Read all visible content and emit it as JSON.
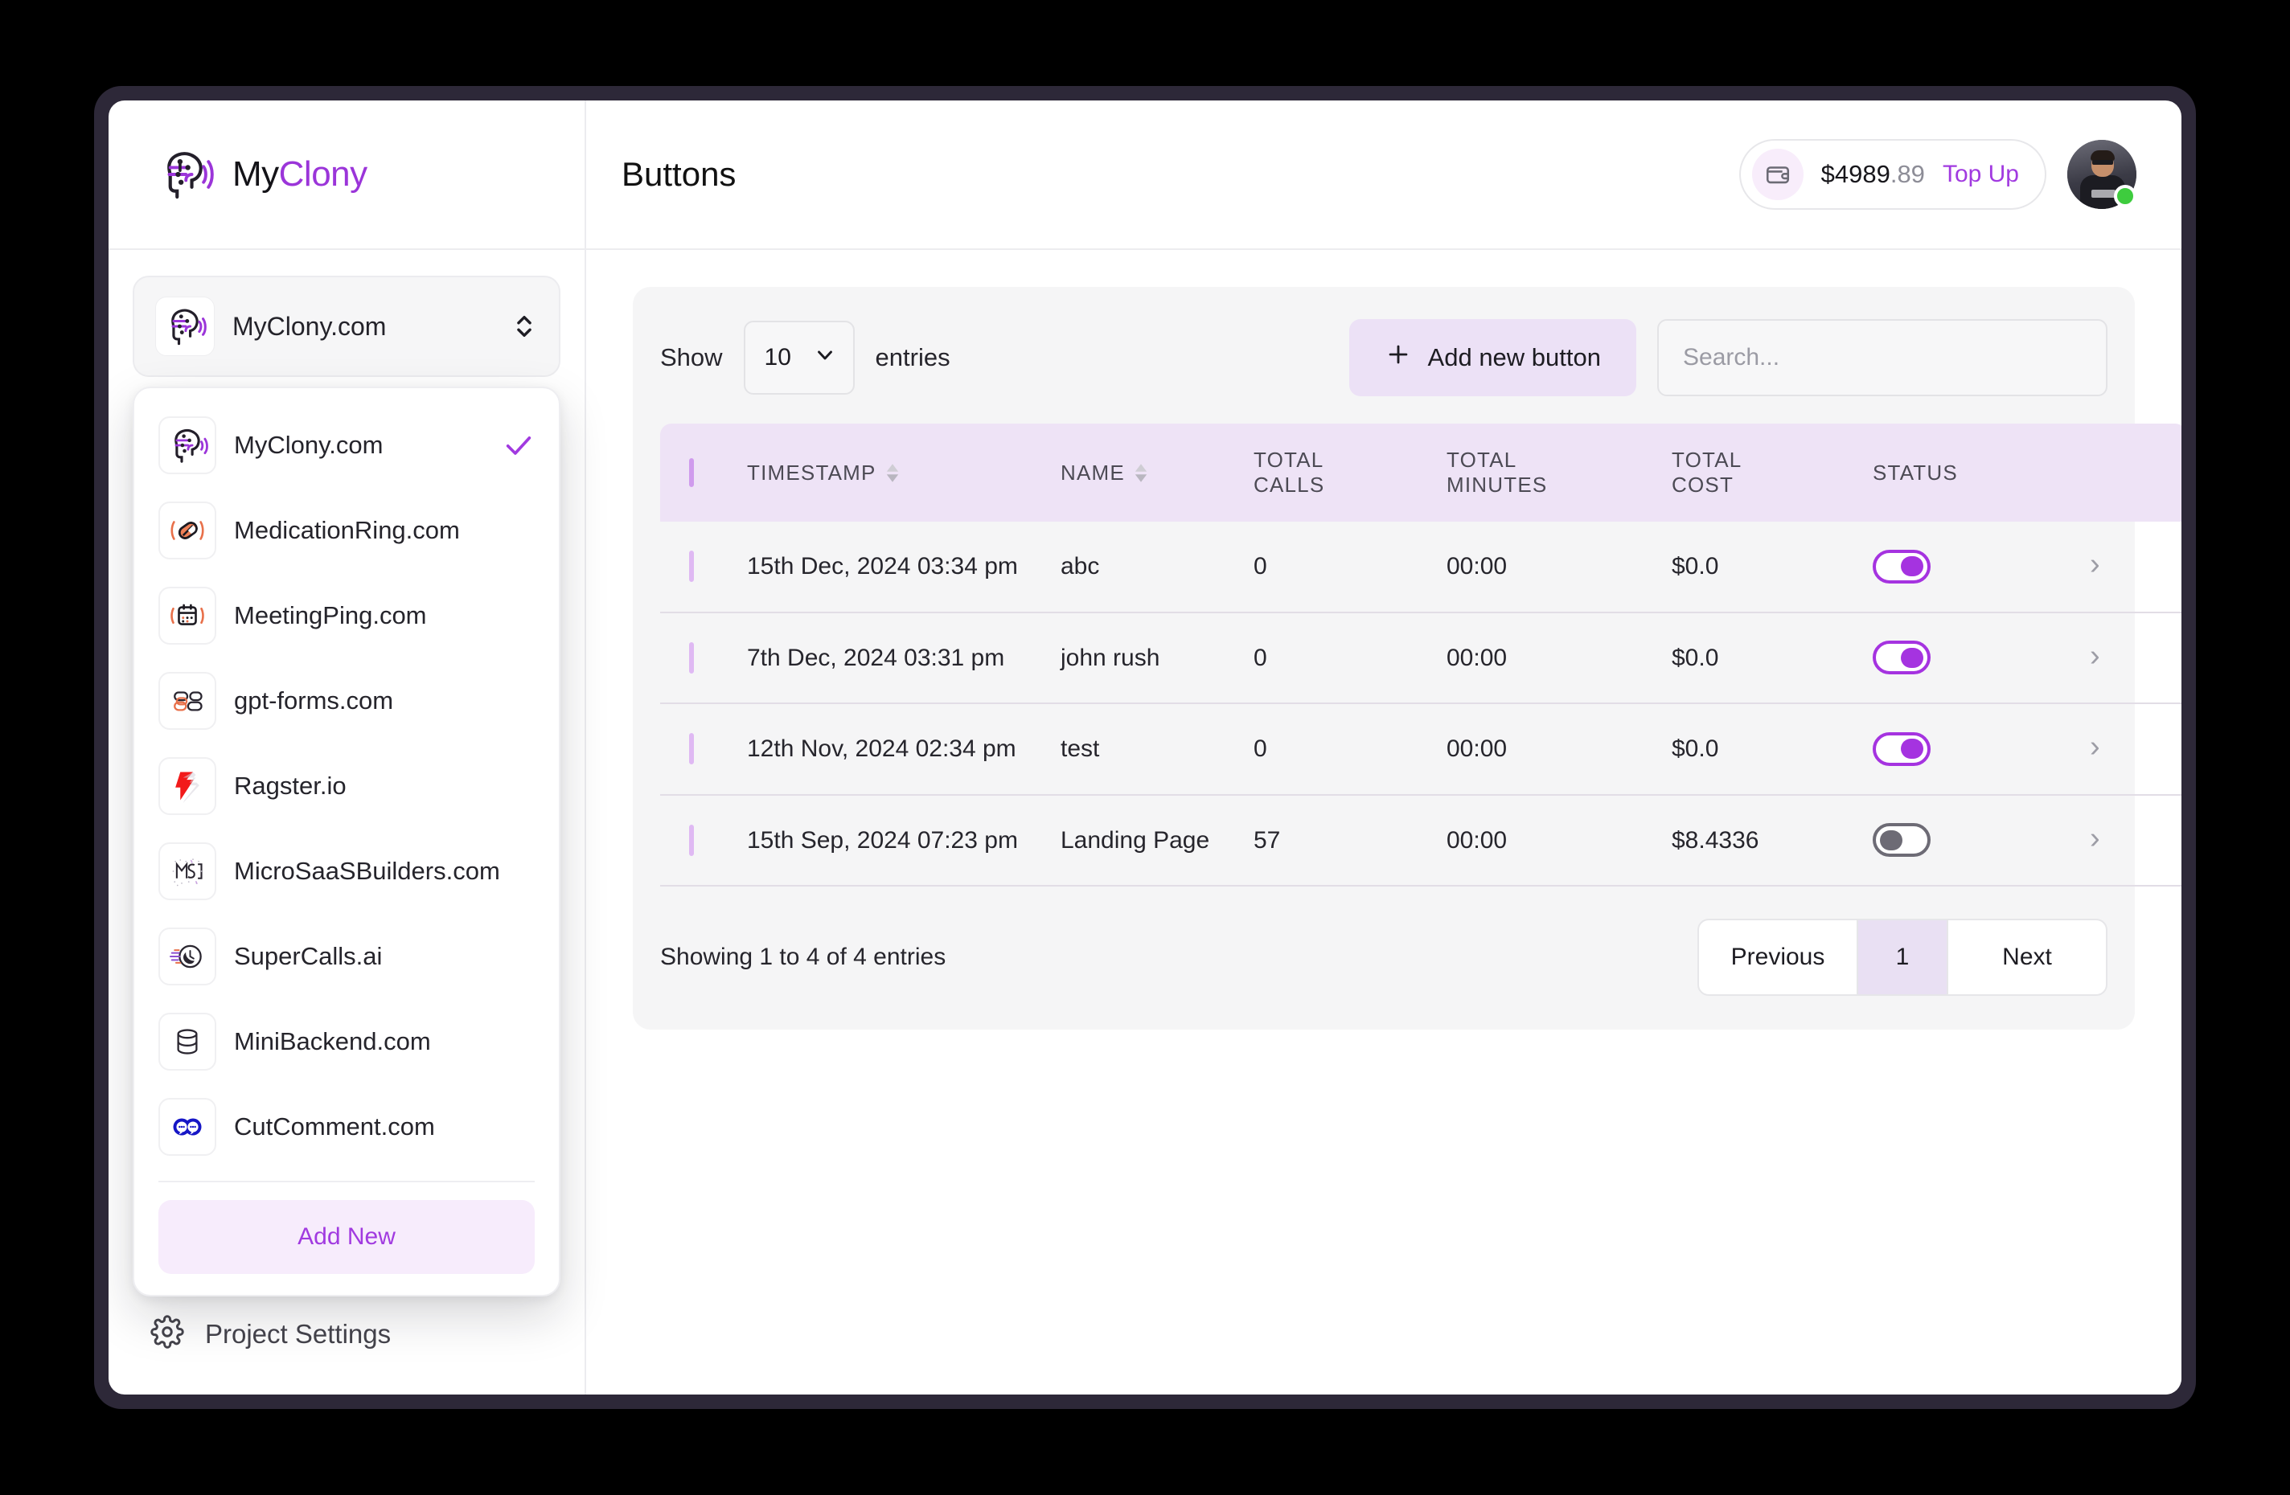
{
  "brand": {
    "name_dark": "My",
    "name_accent": "Clony",
    "logo_icon": "brain-wave-icon"
  },
  "header": {
    "page_title": "Buttons",
    "wallet": {
      "icon": "wallet-icon",
      "amount_main": "$4989",
      "amount_cents": ".89",
      "topup_label": "Top Up"
    },
    "avatar": {
      "name": "user-avatar",
      "status": "online"
    }
  },
  "sidebar": {
    "current_project": {
      "label": "MyClony.com",
      "icon": "brain-wave-icon"
    },
    "settings": {
      "label": "Project Settings",
      "icon": "gear-icon"
    },
    "dropdown": {
      "add_new_label": "Add New",
      "items": [
        {
          "label": "MyClony.com",
          "icon": "brain-wave-icon",
          "selected": true
        },
        {
          "label": "MedicationRing.com",
          "icon": "pill-ring-icon",
          "selected": false
        },
        {
          "label": "MeetingPing.com",
          "icon": "calendar-ring-icon",
          "selected": false
        },
        {
          "label": "gpt-forms.com",
          "icon": "forms-shapes-icon",
          "selected": false
        },
        {
          "label": "Ragster.io",
          "icon": "ragster-r-icon",
          "selected": false
        },
        {
          "label": "MicroSaaSBuilders.com",
          "icon": "msb-glyph-icon",
          "selected": false
        },
        {
          "label": "SuperCalls.ai",
          "icon": "phone-clock-icon",
          "selected": false
        },
        {
          "label": "MiniBackend.com",
          "icon": "database-icon",
          "selected": false
        },
        {
          "label": "CutComment.com",
          "icon": "double-comment-icon",
          "selected": false
        }
      ]
    }
  },
  "toolbar": {
    "show_label": "Show",
    "entries_label": "entries",
    "page_length": "10",
    "add_button_label": "Add new button",
    "search_placeholder": "Search..."
  },
  "table": {
    "columns": [
      "TIMESTAMP",
      "NAME",
      "TOTAL CALLS",
      "TOTAL MINUTES",
      "TOTAL COST",
      "STATUS"
    ],
    "col_total_calls_l1": "TOTAL",
    "col_total_calls_l2": "CALLS",
    "col_total_minutes_l1": "TOTAL",
    "col_total_minutes_l2": "MINUTES",
    "col_total_cost_l1": "TOTAL",
    "col_total_cost_l2": "COST",
    "rows": [
      {
        "timestamp": "15th Dec, 2024 03:34 pm",
        "name": "abc",
        "total_calls": "0",
        "total_minutes": "00:00",
        "total_cost": "$0.0",
        "status": "on"
      },
      {
        "timestamp": "7th Dec, 2024 03:31 pm",
        "name": "john rush",
        "total_calls": "0",
        "total_minutes": "00:00",
        "total_cost": "$0.0",
        "status": "on"
      },
      {
        "timestamp": "12th Nov, 2024 02:34 pm",
        "name": "test",
        "total_calls": "0",
        "total_minutes": "00:00",
        "total_cost": "$0.0",
        "status": "on"
      },
      {
        "timestamp": "15th Sep, 2024 07:23 pm",
        "name": "Landing Page",
        "total_calls": "57",
        "total_minutes": "00:00",
        "total_cost": "$8.4336",
        "status": "off"
      }
    ]
  },
  "footer": {
    "info": "Showing 1 to 4 of 4 entries",
    "previous_label": "Previous",
    "page_number": "1",
    "next_label": "Next"
  },
  "colors": {
    "accent": "#a13ae0",
    "toggle_on": "#a533e0",
    "toggle_off": "#6d6b75",
    "header_row": "#eee3f6",
    "frame": "#2d2838"
  }
}
